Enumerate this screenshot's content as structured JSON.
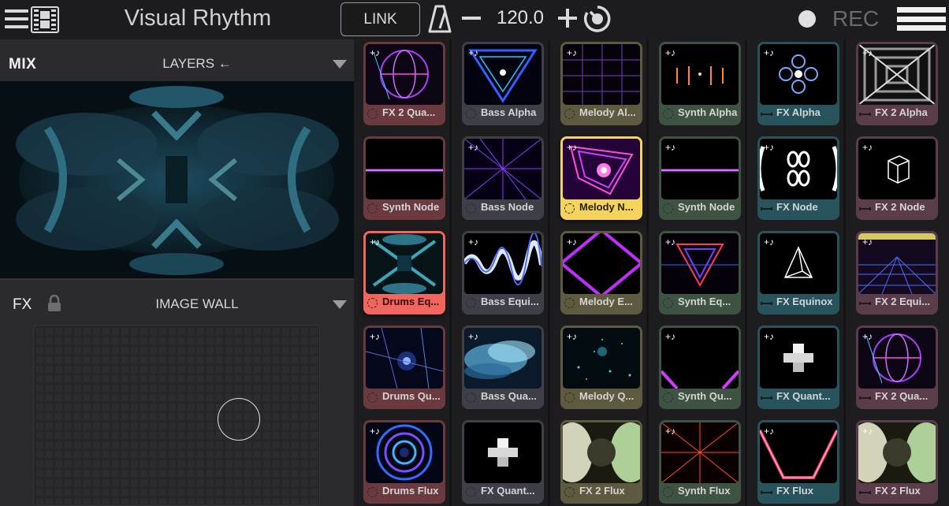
{
  "topbar": {
    "title": "Visual Rhythm",
    "link_label": "LINK",
    "bpm": "120.0",
    "rec_label": "REC"
  },
  "mix_panel": {
    "mix_label": "MIX",
    "layers_label": "LAYERS ←"
  },
  "fx_panel": {
    "fx_label": "FX",
    "wall_label": "IMAGE WALL"
  },
  "colors": {
    "accent_selected": "#f4d45c",
    "accent_playing": "#f0655e",
    "red_track": "#6b3a3e",
    "blue_track": "#3f3f48",
    "olive_track": "#5e5a3f",
    "green_track": "#3e5342",
    "teal_track": "#27535c",
    "plum_track": "#5a3c4a"
  },
  "grid": {
    "columns": [
      {
        "track": "red",
        "clips": [
          {
            "label": "FX 2 Qua...",
            "icon": "note",
            "badge": "trigger",
            "art": "sphere-purple"
          },
          {
            "label": "Synth Node",
            "icon": "none",
            "badge": "trigger",
            "art": "line-purple"
          },
          {
            "label": "Drums Eq...",
            "icon": "note",
            "badge": "trigger",
            "art": "kaleido-teal",
            "state": "playing"
          },
          {
            "label": "Drums Qu...",
            "icon": "note",
            "badge": "trigger",
            "art": "space-blue"
          },
          {
            "label": "Drums Flux",
            "icon": "note",
            "badge": "trigger",
            "art": "rings-blue"
          }
        ]
      },
      {
        "track": "blue",
        "clips": [
          {
            "label": "Bass Alpha",
            "icon": "note",
            "badge": "trigger",
            "art": "triangle-blue"
          },
          {
            "label": "Bass Node",
            "icon": "note",
            "badge": "trigger",
            "art": "burst-purple"
          },
          {
            "label": "Bass Equi...",
            "icon": "note",
            "badge": "trigger",
            "art": "wave-blue"
          },
          {
            "label": "Bass Qua...",
            "icon": "note",
            "badge": "trigger",
            "art": "cloud-cyan"
          },
          {
            "label": "FX Quant...",
            "icon": "none",
            "badge": "trigger",
            "art": "cubes-white"
          }
        ]
      },
      {
        "track": "olive",
        "clips": [
          {
            "label": "Melody Al...",
            "icon": "note",
            "badge": "trigger",
            "art": "grid-purple"
          },
          {
            "label": "Melody N...",
            "icon": "note",
            "badge": "trigger",
            "art": "spiral-magenta",
            "state": "selected"
          },
          {
            "label": "Melody E...",
            "icon": "note",
            "badge": "trigger",
            "art": "diamond-magenta"
          },
          {
            "label": "Melody Q...",
            "icon": "note",
            "badge": "trigger",
            "art": "stars-teal"
          },
          {
            "label": "FX 2 Flux",
            "icon": "none",
            "badge": "trigger",
            "art": "glow-green"
          }
        ]
      },
      {
        "track": "green",
        "clips": [
          {
            "label": "Synth Alpha",
            "icon": "note",
            "badge": "trigger",
            "art": "sparks-orange"
          },
          {
            "label": "Synth Node",
            "icon": "note",
            "badge": "trigger",
            "art": "line-purple"
          },
          {
            "label": "Synth Eq...",
            "icon": "note",
            "badge": "trigger",
            "art": "triangle-red"
          },
          {
            "label": "Synth Qu...",
            "icon": "note",
            "badge": "trigger",
            "art": "corner-magenta"
          },
          {
            "label": "Synth Flux",
            "icon": "note",
            "badge": "trigger",
            "art": "burst-red"
          }
        ]
      },
      {
        "track": "teal",
        "clips": [
          {
            "label": "FX Alpha",
            "icon": "note",
            "badge": "bars",
            "art": "flower-blue"
          },
          {
            "label": "FX Node",
            "icon": "note",
            "badge": "bars",
            "art": "circles-white"
          },
          {
            "label": "FX Equinox",
            "icon": "note",
            "badge": "bars",
            "art": "pyramid-white"
          },
          {
            "label": "FX Quant...",
            "icon": "note",
            "badge": "bars",
            "art": "cubes-white"
          },
          {
            "label": "FX Flux",
            "icon": "note",
            "badge": "bars",
            "art": "v-red"
          }
        ]
      },
      {
        "track": "plum",
        "clips": [
          {
            "label": "FX 2 Alpha",
            "icon": "note",
            "badge": "bars",
            "art": "tunnel-white"
          },
          {
            "label": "FX 2 Node",
            "icon": "note",
            "badge": "bars",
            "art": "cube-outline"
          },
          {
            "label": "FX 2 Equi...",
            "icon": "note",
            "badge": "bars",
            "art": "floor-blue"
          },
          {
            "label": "FX 2 Qua...",
            "icon": "note",
            "badge": "bars",
            "art": "sphere-purple"
          },
          {
            "label": "FX 2 Flux",
            "icon": "note",
            "badge": "bars",
            "art": "glow-green"
          }
        ]
      }
    ]
  }
}
